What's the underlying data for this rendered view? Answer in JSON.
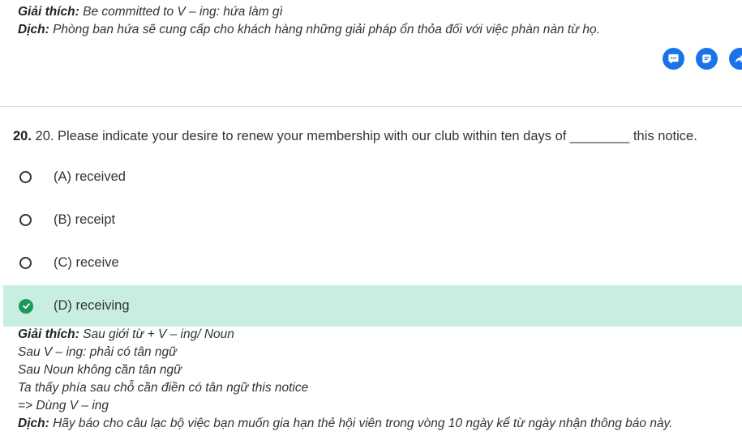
{
  "previous": {
    "explain_label": "Giải thích:",
    "explain_text": "Be committed to V – ing: hứa làm gì",
    "translate_label": "Dịch:",
    "translate_text": "Phòng ban hứa sẽ cung cấp cho khách hàng những giải pháp ổn thỏa đối với việc phàn nàn từ họ."
  },
  "actions": [
    {
      "icon": "chat-icon"
    },
    {
      "icon": "note-icon"
    },
    {
      "icon": "share-icon"
    }
  ],
  "question": {
    "number": "20.",
    "text": "20. Please indicate your desire to renew your membership with our club within ten days of ________ this notice."
  },
  "options": [
    {
      "label": "(A) received",
      "selected": false
    },
    {
      "label": "(B) receipt",
      "selected": false
    },
    {
      "label": "(C) receive",
      "selected": false
    },
    {
      "label": "(D) receiving",
      "selected": true
    }
  ],
  "explanation": {
    "explain_label": "Giải thích:",
    "lines": [
      "Sau giới từ + V – ing/ Noun",
      "Sau V – ing: phải có tân ngữ",
      "Sau Noun không cần tân ngữ",
      "Ta thấy phía sau chỗ cần điền có tân ngữ this notice",
      "=> Dùng V – ing"
    ],
    "translate_label": "Dịch:",
    "translate_text": "Hãy báo cho câu lạc bộ việc bạn muốn gia hạn thẻ hội viên trong vòng 10 ngày kể từ ngày nhận thông báo này."
  },
  "colors": {
    "accent": "#1a73e8",
    "correct_bg": "#c8eee3",
    "correct_icon": "#1d9a5b"
  }
}
